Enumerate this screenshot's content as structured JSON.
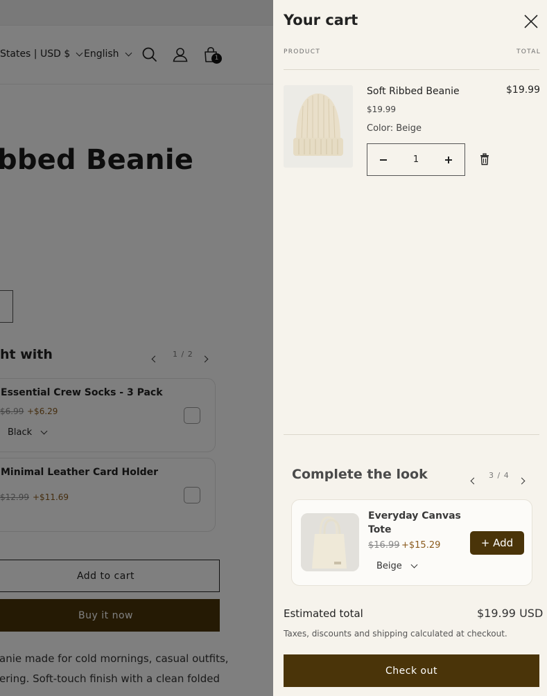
{
  "header": {
    "country_currency": "States | USD $",
    "language": "English",
    "cart_count": "1"
  },
  "product": {
    "title": "bbed Beanie",
    "add_to_cart": "Add to cart",
    "buy_now": "Buy it now",
    "description_lines": [
      "anie made for cold mornings, casual outfits,",
      "ering. Soft-touch finish with a clean folded"
    ]
  },
  "bundle": {
    "heading": "ht with",
    "page": "1 / 2",
    "items": [
      {
        "name": "Essential Crew Socks - 3 Pack",
        "old_price": "$6.99",
        "new_price": "+$6.29",
        "variant": "Black"
      },
      {
        "name": "Minimal Leather Card Holder",
        "old_price": "$12.99",
        "new_price": "+$11.69"
      }
    ]
  },
  "cart": {
    "title": "Your cart",
    "col_product": "PRODUCT",
    "col_total": "TOTAL",
    "item": {
      "name": "Soft Ribbed Beanie",
      "unit_price": "$19.99",
      "variant": "Color: Beige",
      "quantity": "1",
      "line_total": "$19.99"
    },
    "complete_look": {
      "title": "Complete the look",
      "page": "3 / 4",
      "product": {
        "name": "Everyday Canvas Tote",
        "old_price": "$16.99",
        "new_price": "+$15.29",
        "variant": "Beige",
        "add_label": "+ Add"
      }
    },
    "estimated_label": "Estimated total",
    "estimated_value": "$19.99 USD",
    "tax_note": "Taxes, discounts and shipping calculated at checkout.",
    "checkout_label": "Check out"
  },
  "colors": {
    "accent": "#4a3409",
    "drawer_bg": "#f6f3ec",
    "sale_price": "#8a5a1c"
  }
}
